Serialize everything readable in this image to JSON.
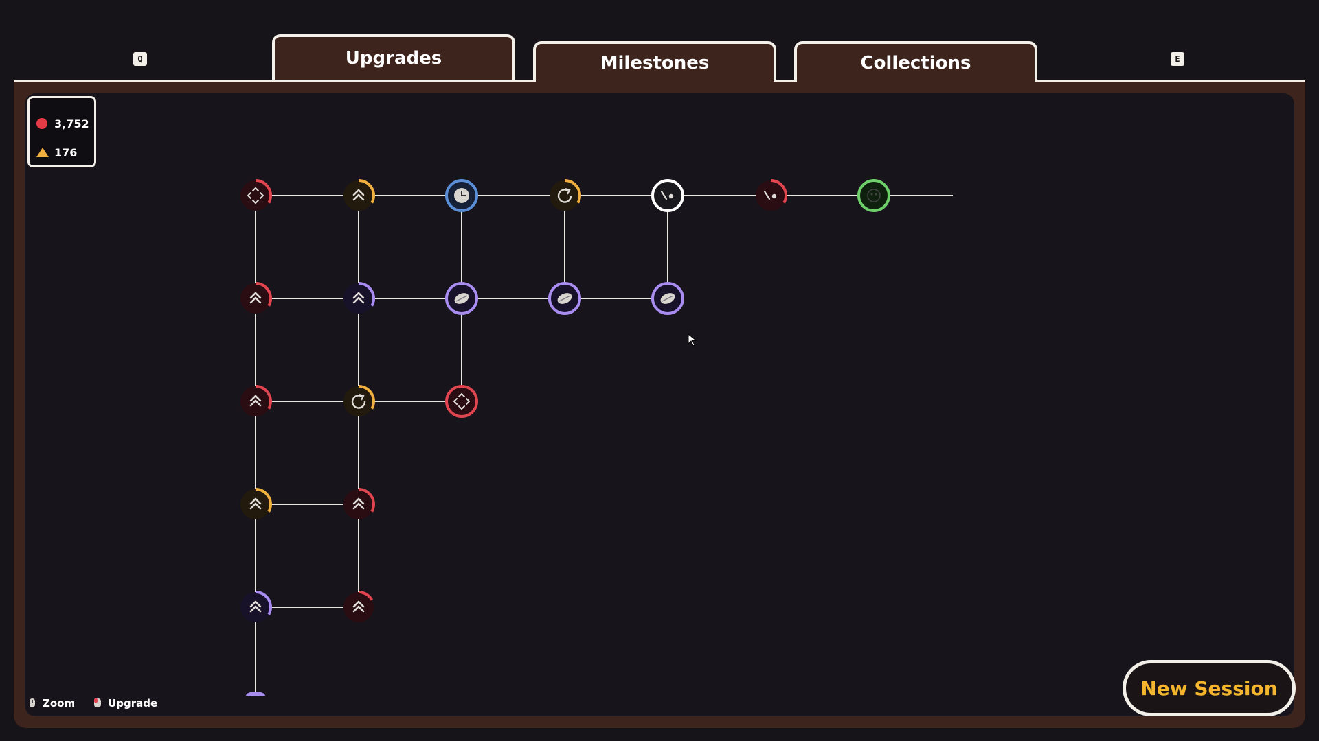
{
  "tabs": [
    {
      "label": "Upgrades",
      "active": true
    },
    {
      "label": "Milestones",
      "active": false
    },
    {
      "label": "Collections",
      "active": false
    }
  ],
  "key_hints": {
    "left": "Q",
    "right": "E"
  },
  "currency": {
    "red_amount": "3,752",
    "gold_amount": "176",
    "red_icon": "red-orb-icon",
    "gold_icon": "gold-triangle-icon"
  },
  "controls": {
    "zoom_label": "Zoom",
    "upgrade_label": "Upgrade"
  },
  "new_session_label": "New Session",
  "colors": {
    "red": "#e04550",
    "gold": "#f0b040",
    "purple": "#a88cf0",
    "blue": "#5a8fd8",
    "green": "#6ed06a",
    "white": "#ffffff",
    "tab_bg": "#3d241c",
    "accent_text": "#f5b62e"
  },
  "nodes": [
    {
      "id": "n00",
      "col": 0,
      "row": 0,
      "icon": "diamond-arrows-icon",
      "ring": "red",
      "progress": 0.33
    },
    {
      "id": "n01",
      "col": 1,
      "row": 0,
      "icon": "double-chevron-icon",
      "ring": "gold",
      "progress": 0.33
    },
    {
      "id": "n02",
      "col": 2,
      "row": 0,
      "icon": "clock-icon",
      "ring": "blue",
      "progress": 1
    },
    {
      "id": "n03",
      "col": 3,
      "row": 0,
      "icon": "rotate-icon",
      "ring": "gold",
      "progress": 0.33
    },
    {
      "id": "n04",
      "col": 4,
      "row": 0,
      "icon": "slingshot-icon",
      "ring": "white",
      "progress": 1
    },
    {
      "id": "n05",
      "col": 5,
      "row": 0,
      "icon": "slingshot-icon",
      "ring": "red",
      "progress": 0.33
    },
    {
      "id": "n06",
      "col": 6,
      "row": 0,
      "icon": "face-icon",
      "ring": "green",
      "progress": 1
    },
    {
      "id": "n10",
      "col": 0,
      "row": 1,
      "icon": "double-chevron-icon",
      "ring": "red",
      "progress": 0.33
    },
    {
      "id": "n11",
      "col": 1,
      "row": 1,
      "icon": "double-chevron-icon",
      "ring": "purple",
      "progress": 0.33
    },
    {
      "id": "n12",
      "col": 2,
      "row": 1,
      "icon": "disc-icon",
      "ring": "purple",
      "progress": 1
    },
    {
      "id": "n13",
      "col": 3,
      "row": 1,
      "icon": "disc-icon",
      "ring": "purple",
      "progress": 1
    },
    {
      "id": "n14",
      "col": 4,
      "row": 1,
      "icon": "disc-icon",
      "ring": "purple",
      "progress": 1
    },
    {
      "id": "n20",
      "col": 0,
      "row": 2,
      "icon": "double-chevron-icon",
      "ring": "red",
      "progress": 0.33
    },
    {
      "id": "n21",
      "col": 1,
      "row": 2,
      "icon": "rotate-icon",
      "ring": "gold",
      "progress": 0.33
    },
    {
      "id": "n22",
      "col": 2,
      "row": 2,
      "icon": "diamond-arrows-icon",
      "ring": "red",
      "progress": 1
    },
    {
      "id": "n30",
      "col": 0,
      "row": 3,
      "icon": "double-chevron-icon",
      "ring": "gold",
      "progress": 0.33
    },
    {
      "id": "n31",
      "col": 1,
      "row": 3,
      "icon": "double-chevron-icon",
      "ring": "red",
      "progress": 0.33
    },
    {
      "id": "n40",
      "col": 0,
      "row": 4,
      "icon": "double-chevron-icon",
      "ring": "purple",
      "progress": 0.33
    },
    {
      "id": "n41",
      "col": 1,
      "row": 4,
      "icon": "double-chevron-icon",
      "ring": "red",
      "progress": 0.17
    }
  ],
  "edges": [
    [
      "n00",
      "n01"
    ],
    [
      "n01",
      "n02"
    ],
    [
      "n02",
      "n03"
    ],
    [
      "n03",
      "n04"
    ],
    [
      "n04",
      "n05"
    ],
    [
      "n05",
      "n06"
    ],
    [
      "n10",
      "n11"
    ],
    [
      "n11",
      "n12"
    ],
    [
      "n12",
      "n13"
    ],
    [
      "n13",
      "n14"
    ],
    [
      "n20",
      "n21"
    ],
    [
      "n21",
      "n22"
    ],
    [
      "n30",
      "n31"
    ],
    [
      "n40",
      "n41"
    ],
    [
      "n00",
      "n10"
    ],
    [
      "n10",
      "n20"
    ],
    [
      "n20",
      "n30"
    ],
    [
      "n30",
      "n40"
    ],
    [
      "n01",
      "n11"
    ],
    [
      "n11",
      "n21"
    ],
    [
      "n21",
      "n31"
    ],
    [
      "n31",
      "n41"
    ],
    [
      "n02",
      "n12"
    ],
    [
      "n12",
      "n22"
    ],
    [
      "n03",
      "n13"
    ],
    [
      "n04",
      "n14"
    ]
  ]
}
